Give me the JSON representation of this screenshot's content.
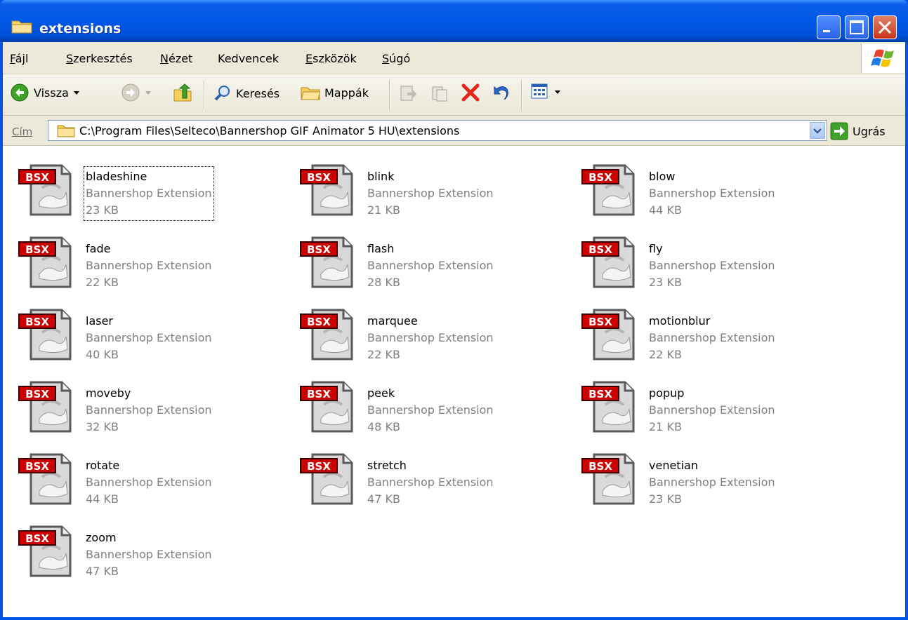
{
  "window": {
    "title": "extensions"
  },
  "menu": [
    {
      "label": "Fájl",
      "u": "F",
      "rest": "ájl"
    },
    {
      "label": "Szerkesztés",
      "u": "S",
      "rest": "zerkesztés"
    },
    {
      "label": "Nézet",
      "u": "N",
      "rest": "ézet"
    },
    {
      "label": "Kedvencek",
      "u": "",
      "rest": "Kedvencek"
    },
    {
      "label": "Eszközök",
      "u": "E",
      "rest": "szközök"
    },
    {
      "label": "Súgó",
      "u": "S",
      "rest": "úgó"
    }
  ],
  "toolbar": {
    "back": "Vissza",
    "search": "Keresés",
    "folders": "Mappák"
  },
  "address": {
    "label": "Cím",
    "value": "C:\\Program Files\\Selteco\\Bannershop GIF Animator 5 HU\\extensions",
    "go": "Ugrás"
  },
  "colors": {
    "accent": "#0054e3",
    "badge": "#cc0000"
  },
  "files": [
    {
      "name": "bladeshine",
      "type": "Bannershop Extension",
      "size": "23 KB",
      "selected": true
    },
    {
      "name": "blink",
      "type": "Bannershop Extension",
      "size": "21 KB"
    },
    {
      "name": "blow",
      "type": "Bannershop Extension",
      "size": "44 KB"
    },
    {
      "name": "fade",
      "type": "Bannershop Extension",
      "size": "22 KB"
    },
    {
      "name": "flash",
      "type": "Bannershop Extension",
      "size": "28 KB"
    },
    {
      "name": "fly",
      "type": "Bannershop Extension",
      "size": "23 KB"
    },
    {
      "name": "laser",
      "type": "Bannershop Extension",
      "size": "40 KB"
    },
    {
      "name": "marquee",
      "type": "Bannershop Extension",
      "size": "22 KB"
    },
    {
      "name": "motionblur",
      "type": "Bannershop Extension",
      "size": "22 KB"
    },
    {
      "name": "moveby",
      "type": "Bannershop Extension",
      "size": "32 KB"
    },
    {
      "name": "peek",
      "type": "Bannershop Extension",
      "size": "48 KB"
    },
    {
      "name": "popup",
      "type": "Bannershop Extension",
      "size": "21 KB"
    },
    {
      "name": "rotate",
      "type": "Bannershop Extension",
      "size": "44 KB"
    },
    {
      "name": "stretch",
      "type": "Bannershop Extension",
      "size": "47 KB"
    },
    {
      "name": "venetian",
      "type": "Bannershop Extension",
      "size": "23 KB"
    },
    {
      "name": "zoom",
      "type": "Bannershop Extension",
      "size": "47 KB"
    }
  ],
  "badge_text": "BSX"
}
